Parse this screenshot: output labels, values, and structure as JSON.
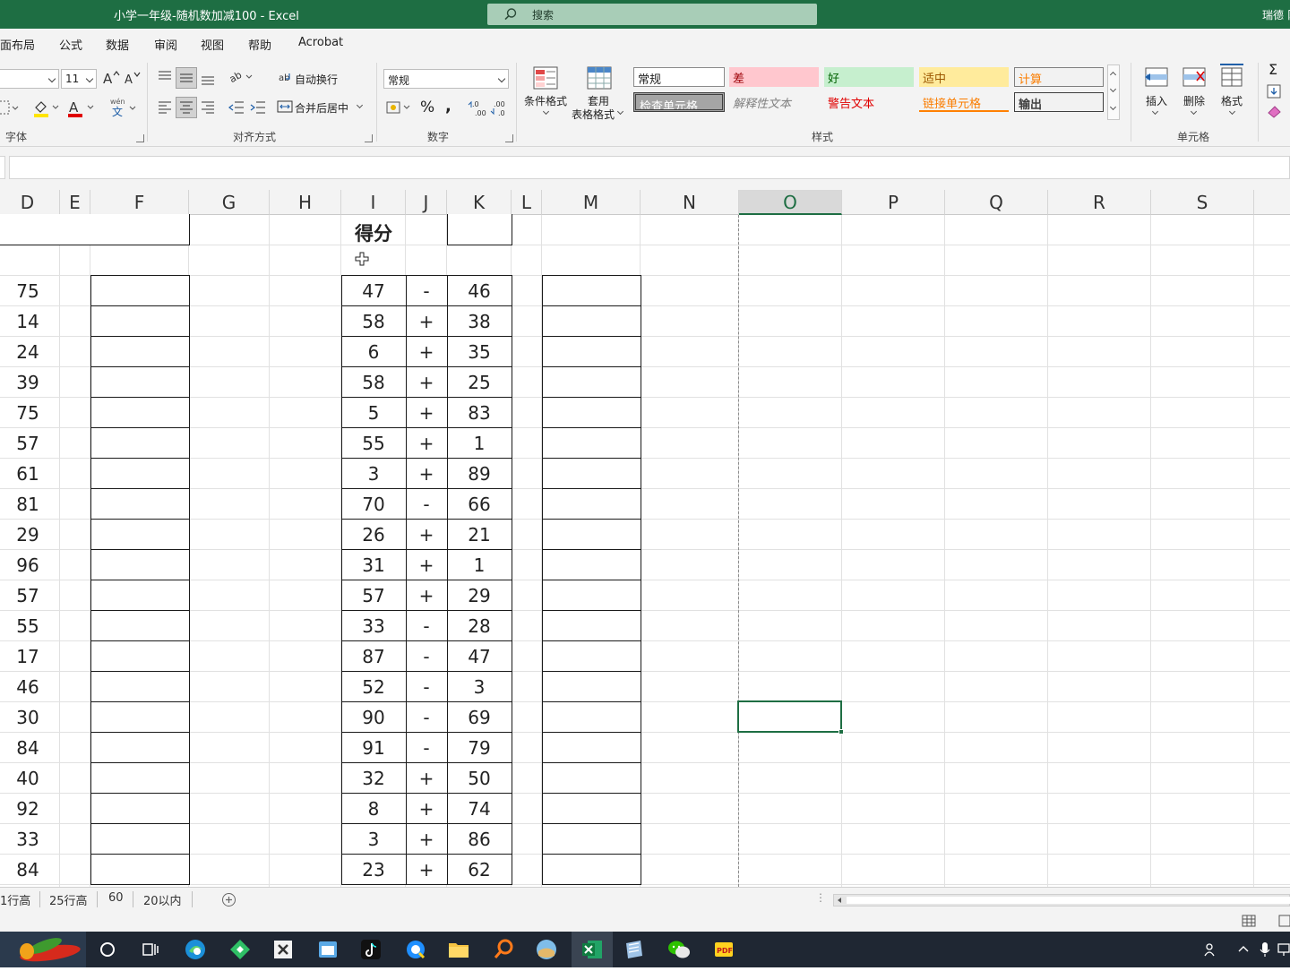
{
  "window": {
    "title": "小学一年级-随机数加减100  -  Excel",
    "search_placeholder": "搜索",
    "user": "瑞德 阝"
  },
  "ribbon_tabs": [
    "面布局",
    "公式",
    "数据",
    "审阅",
    "视图",
    "帮助",
    "Acrobat"
  ],
  "ribbon": {
    "font_name": "",
    "font_size": "11",
    "wrap_text": "自动换行",
    "merge_center": "合并后居中",
    "number_format": "常规",
    "cond_format": "条件格式",
    "table_format_1": "套用",
    "table_format_2": "表格格式",
    "styles": {
      "normal": "常规",
      "bad": "差",
      "good": "好",
      "neutral": "适中",
      "calc": "计算",
      "check": "检查单元格",
      "explain": "解释性文本",
      "warn": "警告文本",
      "linked": "链接单元格",
      "output": "输出"
    },
    "insert": "插入",
    "delete": "删除",
    "format": "格式",
    "groups": {
      "font": "字体",
      "align": "对齐方式",
      "number": "数字",
      "styles": "样式",
      "cells": "单元格"
    },
    "colors": {
      "bad_bg": "#ffc7ce",
      "good_bg": "#c6efce",
      "neutral_bg": "#ffeb9c",
      "check_bg": "#a5a5a5",
      "accent": "#1e6e43"
    }
  },
  "columns": [
    "D",
    "E",
    "F",
    "G",
    "H",
    "I",
    "J",
    "K",
    "L",
    "M",
    "N",
    "O",
    "P",
    "Q",
    "R",
    "S"
  ],
  "selected_column": "O",
  "score_label": "得分",
  "d_values": [
    "75",
    "14",
    "24",
    "39",
    "75",
    "57",
    "61",
    "81",
    "29",
    "96",
    "57",
    "55",
    "17",
    "46",
    "30",
    "84",
    "40",
    "92",
    "33",
    "84"
  ],
  "problems": [
    {
      "a": "47",
      "op": "-",
      "b": "46"
    },
    {
      "a": "58",
      "op": "+",
      "b": "38"
    },
    {
      "a": "6",
      "op": "+",
      "b": "35"
    },
    {
      "a": "58",
      "op": "+",
      "b": "25"
    },
    {
      "a": "5",
      "op": "+",
      "b": "83"
    },
    {
      "a": "55",
      "op": "+",
      "b": "1"
    },
    {
      "a": "3",
      "op": "+",
      "b": "89"
    },
    {
      "a": "70",
      "op": "-",
      "b": "66"
    },
    {
      "a": "26",
      "op": "+",
      "b": "21"
    },
    {
      "a": "31",
      "op": "+",
      "b": "1"
    },
    {
      "a": "57",
      "op": "+",
      "b": "29"
    },
    {
      "a": "33",
      "op": "-",
      "b": "28"
    },
    {
      "a": "87",
      "op": "-",
      "b": "47"
    },
    {
      "a": "52",
      "op": "-",
      "b": "3"
    },
    {
      "a": "90",
      "op": "-",
      "b": "69"
    },
    {
      "a": "91",
      "op": "-",
      "b": "79"
    },
    {
      "a": "32",
      "op": "+",
      "b": "50"
    },
    {
      "a": "8",
      "op": "+",
      "b": "74"
    },
    {
      "a": "3",
      "op": "+",
      "b": "86"
    },
    {
      "a": "23",
      "op": "+",
      "b": "62"
    }
  ],
  "sheet_tabs": [
    "1行高",
    "25行高",
    "60",
    "20以内"
  ]
}
